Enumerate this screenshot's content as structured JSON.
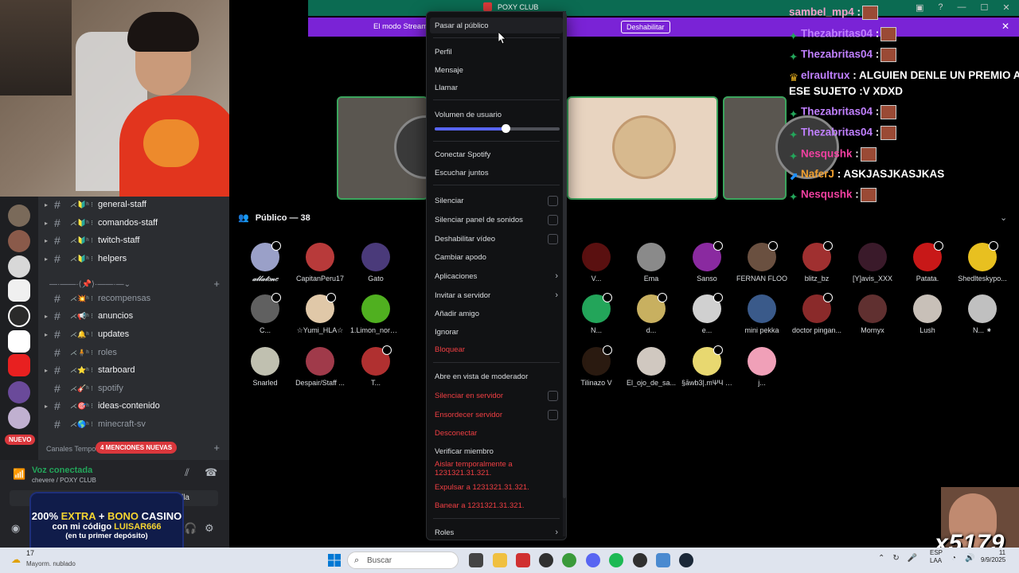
{
  "stream_title": "POXY CLUB",
  "banner": {
    "text": "El modo Stream... han truncado.",
    "button": "Deshabilitar",
    "close": "✕"
  },
  "window_controls": [
    "—",
    "☐",
    "✕"
  ],
  "context_menu": {
    "pasar_publico": "Pasar al público",
    "perfil": "Perfil",
    "mensaje": "Mensaje",
    "llamar": "Llamar",
    "volumen": "Volumen de usuario",
    "volume_level": 0.57,
    "conectar_spotify": "Conectar Spotify",
    "escuchar_juntos": "Escuchar juntos",
    "silenciar": "Silenciar",
    "silenciar_panel": "Silenciar panel de sonidos",
    "deshabilitar_video": "Deshabilitar vídeo",
    "cambiar_apodo": "Cambiar apodo",
    "aplicaciones": "Aplicaciones",
    "invitar": "Invitar a servidor",
    "anadir_amigo": "Añadir amigo",
    "ignorar": "Ignorar",
    "bloquear": "Bloquear",
    "moderador": "Abre en vista de moderador",
    "silenciar_servidor": "Silenciar en servidor",
    "ensordecer_servidor": "Ensordecer servidor",
    "desconectar": "Desconectar",
    "verificar": "Verificar miembro",
    "aislar": "Aislar temporalmente a 1231321.31.321.",
    "expulsar": "Expulsar a 1231321.31.321.",
    "banear": "Banear a 1231321.31.321.",
    "roles": "Roles",
    "chevron": "›"
  },
  "channels": [
    {
      "name": "general-staff",
      "emoji": "⋌🔰ʰ ⁝",
      "style": "bold"
    },
    {
      "name": "comandos-staff",
      "emoji": "⋌🔰ʰ ⁝",
      "style": "bold"
    },
    {
      "name": "twitch-staff",
      "emoji": "⋌🔰ʰ ⁝",
      "style": "bold"
    },
    {
      "name": "helpers",
      "emoji": "⋌🔰ʰ ⁝",
      "style": "bold"
    },
    {
      "name": "recompensas",
      "emoji": "⋌💥ʰ ⁝",
      "style": "muted"
    },
    {
      "name": "anuncios",
      "emoji": "⋌📢ʰ ⁝",
      "style": "bold"
    },
    {
      "name": "updates",
      "emoji": "⋌🔔ʰ ⁝",
      "style": "bold"
    },
    {
      "name": "roles",
      "emoji": "⋌🧍ʰ ⁝",
      "style": "muted"
    },
    {
      "name": "starboard",
      "emoji": "⋌⭐ʰ ⁝",
      "style": "bold"
    },
    {
      "name": "spotify",
      "emoji": "⋌🎸ʰ ⁝",
      "style": "muted"
    },
    {
      "name": "ideas-contenido",
      "emoji": "⋌🎯ʰ ⁝",
      "style": "bold"
    },
    {
      "name": "minecraft-sv",
      "emoji": "⋌🌎ʰ ⁝",
      "style": "muted"
    }
  ],
  "channel_divider": "—·——·⟨📌⟩·——·—⌄",
  "category": "Canales Tempo",
  "mentions_badge": "4 MENCIONES NUEVAS",
  "nuevo_badge": "NUEVO",
  "voice": {
    "title": "Voz conectada",
    "subtitle": "chevere / POXY CLUB",
    "wide_button_label": "lla"
  },
  "ad": {
    "line1_a": "200% ",
    "line1_b": "EXTRA",
    "line1_c": " + ",
    "line1_d": "BONO",
    "line1_e": " CASINO",
    "line2_a": "con mi código ",
    "line2_b": "LUISAR666",
    "line3": "(en tu primer depósito)"
  },
  "audience": {
    "label": "Público — 38"
  },
  "members_row1": [
    {
      "name": "𝒶𝓁𝓁𝒶𝓉𝑜𝓃𝑒",
      "color": "#9aa0c8",
      "italic": true
    },
    {
      "name": "CapitanPeru17",
      "color": "#b83a3a"
    },
    {
      "name": "Gato",
      "color": "#4a3a7a"
    },
    {
      "name": "V...",
      "color": "#5a1010"
    },
    {
      "name": "Ema",
      "color": "#8a8a8a"
    },
    {
      "name": "Sanso",
      "color": "#8a2aa0"
    },
    {
      "name": "FERNAN FLOO",
      "color": "#6a5040"
    },
    {
      "name": "blitz_bz",
      "color": "#a03030"
    },
    {
      "name": "[Y]avis_XXX",
      "color": "#3a1a2a"
    },
    {
      "name": "Patata.",
      "color": "#c81818"
    },
    {
      "name": "Shedlteskypo...",
      "color": "#e8c020"
    }
  ],
  "members_row2": [
    {
      "name": "C...",
      "color": "#606060"
    },
    {
      "name": "☆Yumi_HLA☆",
      "color": "#e0c8a8"
    },
    {
      "name": "1.Limon_norm...",
      "color": "#50b020"
    },
    {
      "name": "N...",
      "color": "#23a55a"
    },
    {
      "name": "d...",
      "color": "#c8b060"
    },
    {
      "name": "e...",
      "color": "#d0d0d0"
    },
    {
      "name": "mini pekka",
      "color": "#3a5a8a"
    },
    {
      "name": "doctor pingan...",
      "color": "#8a2a2a"
    },
    {
      "name": "Mornyx",
      "color": "#603030"
    },
    {
      "name": "Lush",
      "color": "#c8c0b8"
    },
    {
      "name": "N... ⁕",
      "color": "#c0c0c0"
    }
  ],
  "members_row3": [
    {
      "name": "Snarled",
      "color": "#c0c0b0"
    },
    {
      "name": "Despair/Staff ...",
      "color": "#a03a4a"
    },
    {
      "name": "T...",
      "color": "#b03030"
    },
    {
      "name": "Tilinazo V",
      "color": "#2a1a10"
    },
    {
      "name": "El_ojo_de_sa...",
      "color": "#d0c8c0"
    },
    {
      "name": "§āwb3|.mΨЧ f...",
      "color": "#e8d870"
    },
    {
      "name": "j...",
      "color": "#f0a0b8"
    }
  ],
  "chat": [
    {
      "user": "sambel_mp4",
      "msg": " :",
      "color": "#f0a0c8",
      "badge": ""
    },
    {
      "user": "Thezabritas04",
      "msg": " :",
      "color": "#c080ff",
      "badge": "#23a55a"
    },
    {
      "user": "Thezabritas04",
      "msg": " :",
      "color": "#c080ff",
      "badge": "#23a55a"
    },
    {
      "user": "elraultrux",
      "msg": " : ALGUIEN DENLE UN PREMIO A",
      "color": "#c080ff",
      "badge": "#e8b020"
    },
    {
      "user": "",
      "msg": "ESE SUJETO :V XDXD",
      "color": "#fff",
      "badge": ""
    },
    {
      "user": "Thezabritas04",
      "msg": " :",
      "color": "#c080ff",
      "badge": "#23a55a"
    },
    {
      "user": "Thezabritas04",
      "msg": " :",
      "color": "#c080ff",
      "badge": "#23a55a"
    },
    {
      "user": "Nesqushk",
      "msg": " :",
      "color": "#f040a0",
      "badge": "#23a55a"
    },
    {
      "user": "NaferJ",
      "msg": " : ASKJASJKASJKAS",
      "color": "#f0a030",
      "badge": "#1e90ff"
    },
    {
      "user": "Nesqushk",
      "msg": " :",
      "color": "#f040a0",
      "badge": "#23a55a"
    }
  ],
  "meme_text": "x5179",
  "taskbar": {
    "weather_temp": "17",
    "weather_desc": "Mayorm. nublado",
    "search_placeholder": "Buscar",
    "tray_text": "ESP\nLAA",
    "time": "11",
    "date": "9/9/2025"
  }
}
